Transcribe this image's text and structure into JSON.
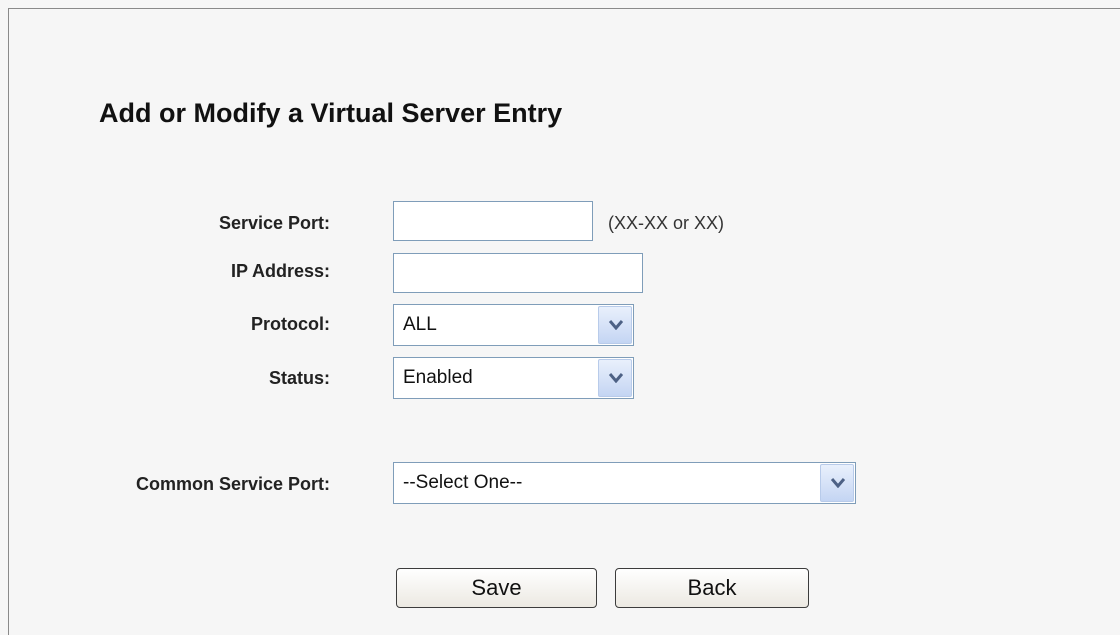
{
  "page": {
    "title": "Add or Modify a Virtual Server Entry"
  },
  "form": {
    "service_port": {
      "label": "Service Port:",
      "value": "",
      "hint": "(XX-XX or XX)"
    },
    "ip_address": {
      "label": "IP Address:",
      "value": ""
    },
    "protocol": {
      "label": "Protocol:",
      "selected": "ALL"
    },
    "status": {
      "label": "Status:",
      "selected": "Enabled"
    },
    "common_service_port": {
      "label": "Common Service Port:",
      "selected": "--Select One--"
    }
  },
  "buttons": {
    "save": "Save",
    "back": "Back"
  },
  "icons": {
    "dropdown": "chevron-down-icon"
  },
  "colors": {
    "background": "#f6f6f6",
    "input_border": "#7f9db9",
    "dropdown_arrow": "#4d6185"
  }
}
